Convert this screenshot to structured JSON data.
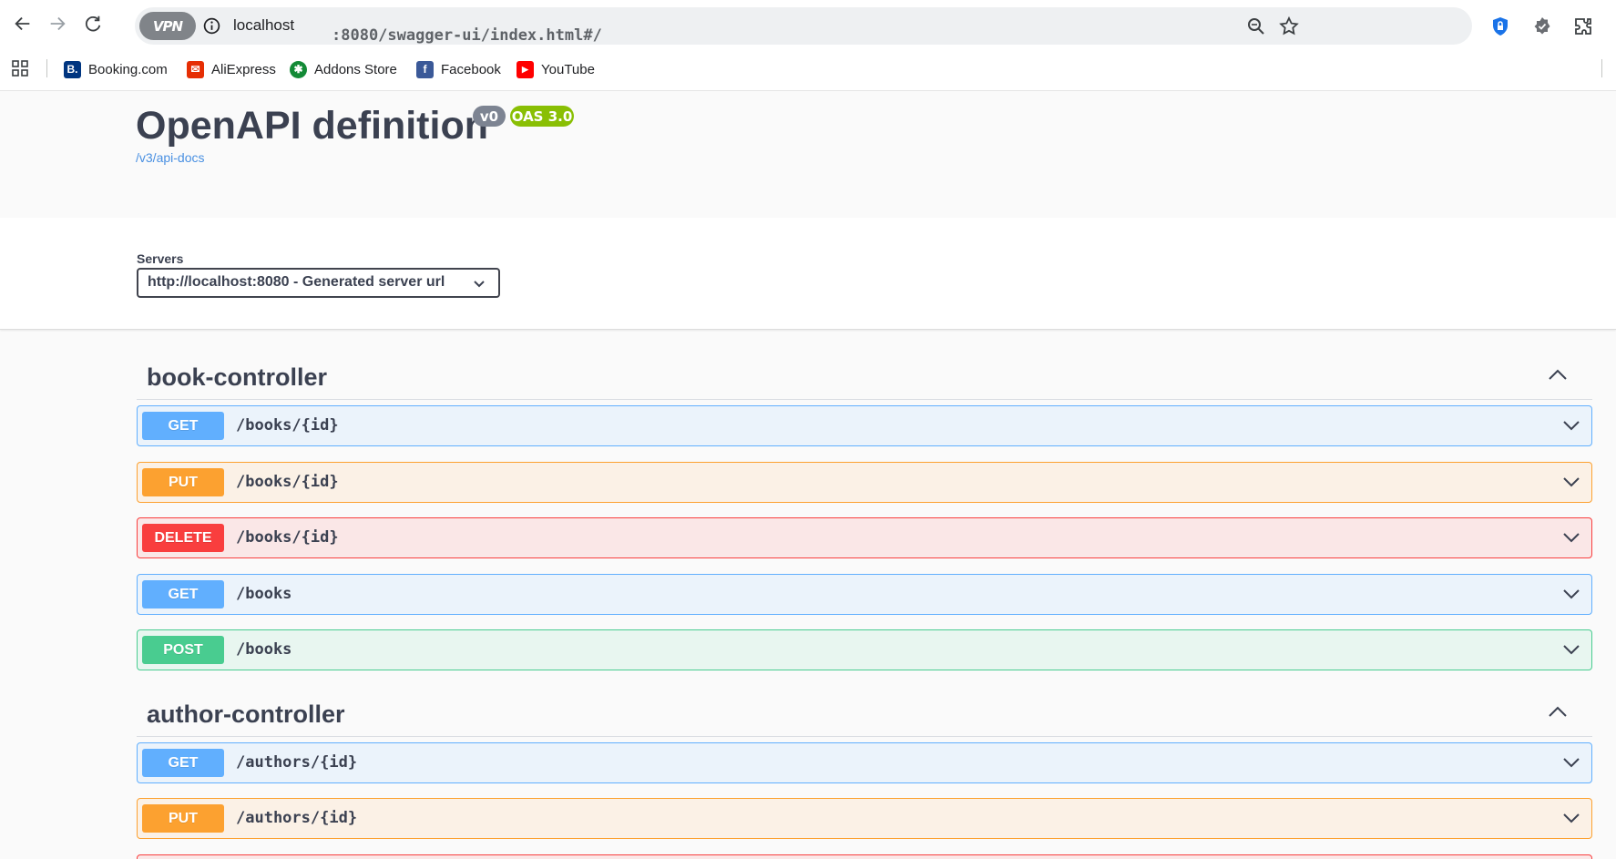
{
  "browser": {
    "url_host": "localhost",
    "url_path": ":8080/swagger-ui/index.html#/",
    "vpn_label": "VPN",
    "bookmarks": [
      {
        "label": "Booking.com",
        "icon": "booking-icon",
        "color": "#003580",
        "glyph": "B."
      },
      {
        "label": "AliExpress",
        "icon": "aliexpress-icon",
        "color": "#e62e04",
        "glyph": "✉"
      },
      {
        "label": "Addons Store",
        "icon": "addons-store-icon",
        "color": "#138a36",
        "glyph": "✱"
      },
      {
        "label": "Facebook",
        "icon": "facebook-icon",
        "color": "#3b5998",
        "glyph": "f"
      },
      {
        "label": "YouTube",
        "icon": "youtube-icon",
        "color": "#ff0000",
        "glyph": "▶"
      }
    ]
  },
  "info": {
    "title": "OpenAPI definition",
    "version_badge": "v0",
    "oas_badge": "OAS 3.0",
    "link": "/v3/api-docs"
  },
  "servers": {
    "label": "Servers",
    "selected": "http://localhost:8080 - Generated server url"
  },
  "tags": [
    {
      "name": "book-controller",
      "operations": [
        {
          "method": "GET",
          "path": "/books/{id}"
        },
        {
          "method": "PUT",
          "path": "/books/{id}"
        },
        {
          "method": "DELETE",
          "path": "/books/{id}"
        },
        {
          "method": "GET",
          "path": "/books"
        },
        {
          "method": "POST",
          "path": "/books"
        }
      ]
    },
    {
      "name": "author-controller",
      "operations": [
        {
          "method": "GET",
          "path": "/authors/{id}"
        },
        {
          "method": "PUT",
          "path": "/authors/{id}"
        }
      ]
    }
  ],
  "colors": {
    "get": "#61affe",
    "put": "#fca130",
    "delete": "#f93e3e",
    "post": "#49cc90",
    "oas_badge": "#89bf04",
    "version_badge": "#7d8492"
  }
}
